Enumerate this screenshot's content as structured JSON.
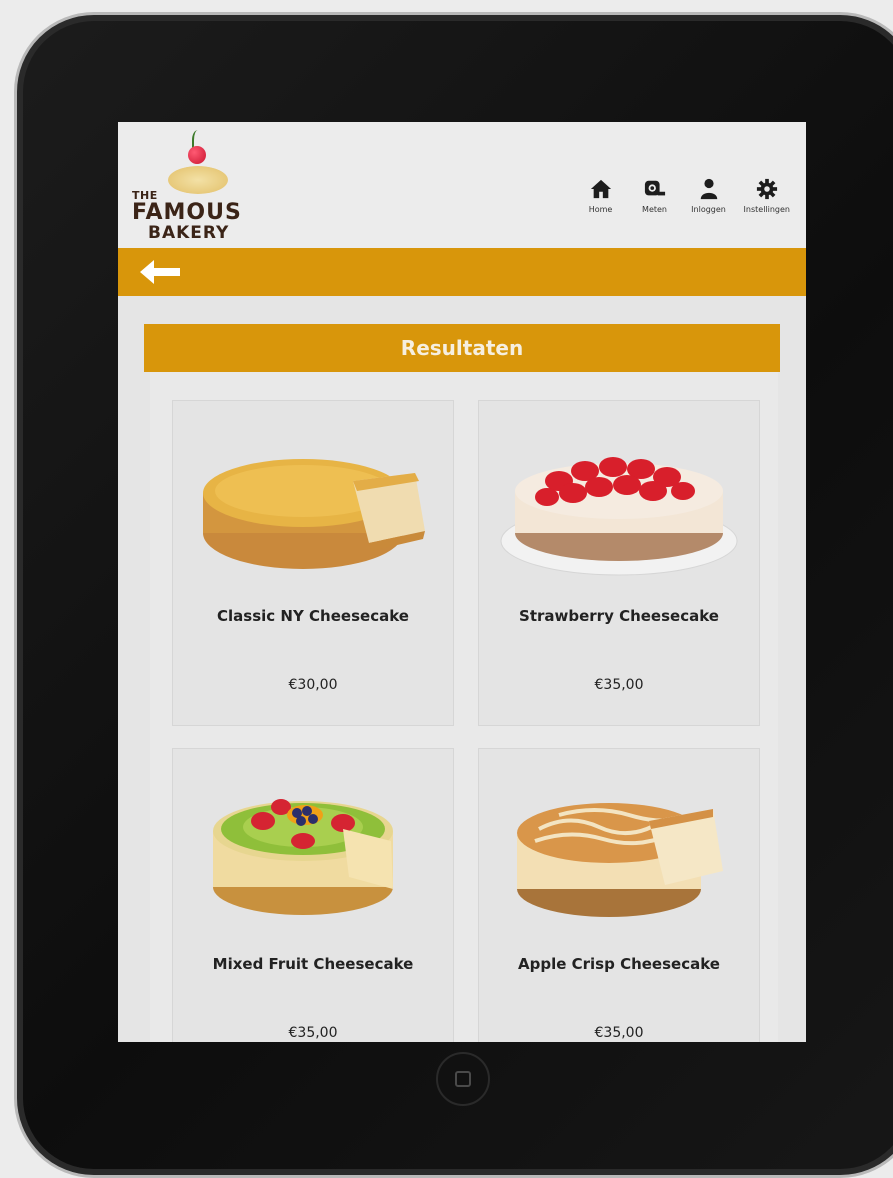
{
  "brand": {
    "line1": "THE",
    "line2": "FAMOUS",
    "line3": "BAKERY"
  },
  "nav": [
    {
      "label": "Home",
      "icon": "home-icon"
    },
    {
      "label": "Meten",
      "icon": "measuring-tape-icon"
    },
    {
      "label": "Inloggen",
      "icon": "user-icon"
    },
    {
      "label": "Instellingen",
      "icon": "gear-icon"
    }
  ],
  "results": {
    "title": "Resultaten",
    "items": [
      {
        "name": "Classic NY Cheesecake",
        "price": "€30,00"
      },
      {
        "name": "Strawberry Cheesecake",
        "price": "€35,00"
      },
      {
        "name": "Mixed Fruit Cheesecake",
        "price": "€35,00"
      },
      {
        "name": "Apple Crisp Cheesecake",
        "price": "€35,00"
      }
    ]
  },
  "colors": {
    "accent": "#d8960b",
    "bezel": "#111111",
    "screen_bg": "#e5e5e5"
  }
}
